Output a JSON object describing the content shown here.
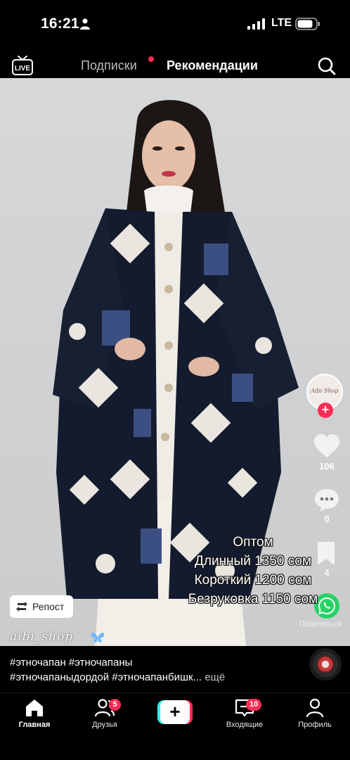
{
  "status_bar": {
    "time": "16:21",
    "network": "LTE"
  },
  "top_nav": {
    "live_label": "LIVE",
    "tabs": [
      {
        "label": "Подписки",
        "has_dot": true
      },
      {
        "label": "Рекомендации",
        "active": true
      }
    ]
  },
  "video": {
    "overlay_lines": [
      "Оптом",
      "Длинный 1350 сом",
      "Короткий 1200 сом",
      "Безруковка  1150 сом"
    ],
    "watermark": "aibi_shop",
    "repost_label": "Репост"
  },
  "right_rail": {
    "avatar_text": "Aibi Shop",
    "likes": "106",
    "comments": "0",
    "bookmarks": "4",
    "share_label": "Поделиться"
  },
  "caption": {
    "line1": "#этночапан #этночапаны",
    "line2": "#этночапаныдордой #этночапанбишк...",
    "more": "ещё"
  },
  "bottom_nav": {
    "items": [
      {
        "label": "Главная",
        "active": true
      },
      {
        "label": "Друзья",
        "badge": "5"
      },
      {
        "label": ""
      },
      {
        "label": "Входящие",
        "badge": "10"
      },
      {
        "label": "Профиль"
      }
    ]
  },
  "colors": {
    "accent_red": "#fe2c55",
    "accent_cyan": "#25f4ee",
    "background": "#000000"
  }
}
